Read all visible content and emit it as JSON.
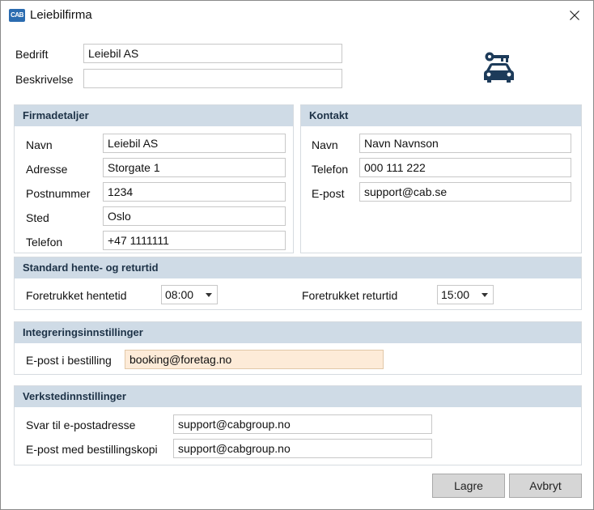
{
  "window": {
    "title": "Leiebilfirma",
    "app_icon": "CAB",
    "close_icon": "close-icon"
  },
  "company": {
    "bedrift_label": "Bedrift",
    "bedrift_value": "Leiebil AS",
    "beskrivelse_label": "Beskrivelse",
    "beskrivelse_value": "",
    "illustration_icon": "car-key-icon",
    "illustration_color": "#1d3b5a"
  },
  "firmadetaljer": {
    "title": "Firmadetaljer",
    "navn_label": "Navn",
    "navn_value": "Leiebil AS",
    "adresse_label": "Adresse",
    "adresse_value": "Storgate 1",
    "postnummer_label": "Postnummer",
    "postnummer_value": "1234",
    "sted_label": "Sted",
    "sted_value": "Oslo",
    "telefon_label": "Telefon",
    "telefon_value": "+47 1111111"
  },
  "kontakt": {
    "title": "Kontakt",
    "navn_label": "Navn",
    "navn_value": "Navn Navnson",
    "telefon_label": "Telefon",
    "telefon_value": "000 111 222",
    "epost_label": "E-post",
    "epost_value": "support@cab.se"
  },
  "hente": {
    "title": "Standard hente- og returtid",
    "hentetid_label": "Foretrukket hentetid",
    "hentetid_value": "08:00",
    "returtid_label": "Foretrukket returtid",
    "returtid_value": "15:00"
  },
  "integrering": {
    "title": "Integreringsinnstillinger",
    "epost_label": "E-post i bestilling",
    "epost_value": "booking@foretag.no"
  },
  "verksted": {
    "title": "Verkstedinnstillinger",
    "svar_label": "Svar til e-postadresse",
    "svar_value": "support@cabgroup.no",
    "kopi_label": "E-post med bestillingskopi",
    "kopi_value": "support@cabgroup.no"
  },
  "buttons": {
    "save_label": "Lagre",
    "cancel_label": "Avbryt"
  },
  "colors": {
    "section_header_bg": "#cfdbe6",
    "highlight_field_bg": "#fdebd8",
    "button_bg": "#d6d6d6"
  }
}
